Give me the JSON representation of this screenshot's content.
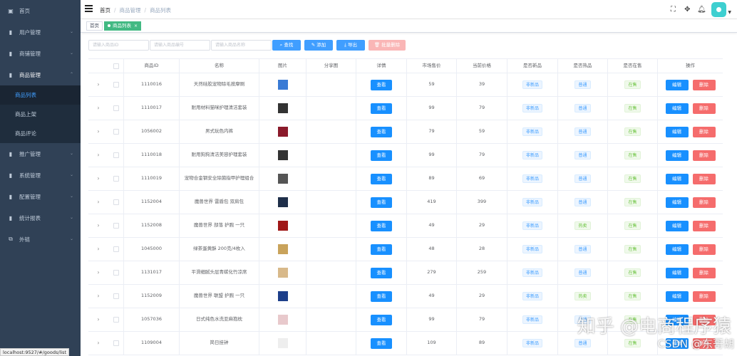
{
  "sidebar": {
    "items": [
      {
        "label": "首页",
        "icon": "dashboard-icon",
        "chevron": false
      },
      {
        "label": "用户管理",
        "icon": "bar-chart-icon",
        "chevron": true
      },
      {
        "label": "商铺管理",
        "icon": "bar-chart-icon",
        "chevron": true
      },
      {
        "label": "商品管理",
        "icon": "bar-chart-icon",
        "chevron": true,
        "open": true
      },
      {
        "label": "推广管理",
        "icon": "bar-chart-icon",
        "chevron": true
      },
      {
        "label": "系统管理",
        "icon": "bar-chart-icon",
        "chevron": true
      },
      {
        "label": "配置管理",
        "icon": "bar-chart-icon",
        "chevron": true
      },
      {
        "label": "统计报表",
        "icon": "bar-chart-icon",
        "chevron": true
      },
      {
        "label": "外链",
        "icon": "external-link-icon",
        "chevron": true
      }
    ],
    "sub_items": [
      "商品列表",
      "商品上架",
      "商品评论"
    ],
    "status_url": "localhost:9527/#/goods/list"
  },
  "navbar": {
    "breadcrumb": [
      "首页",
      "商品管理",
      "商品列表"
    ]
  },
  "tags": {
    "home": "首页",
    "active": "商品列表",
    "close": "×"
  },
  "filters": {
    "id_placeholder": "请输入商品ID",
    "code_placeholder": "请输入商品编号",
    "name_placeholder": "请输入商品名称",
    "search_label": "查找",
    "add_label": "添加",
    "export_label": "导出",
    "batch_delete_label": "批量删除"
  },
  "table": {
    "headers": [
      "商品ID",
      "名称",
      "图片",
      "分享图",
      "详情",
      "市场售价",
      "当前价格",
      "是否新品",
      "是否热品",
      "是否在售",
      "操作"
    ],
    "view_label": "查看",
    "edit_label": "编辑",
    "delete_label": "删除",
    "rows": [
      {
        "id": "1110016",
        "name": "天然硅胶宠物除毛按摩刷",
        "market": "59",
        "price": "39",
        "is_new": "非新品",
        "is_hot": "普通",
        "on_sale": "在售",
        "thumb_color": "#3a7bd5"
      },
      {
        "id": "1110017",
        "name": "耐用材料猫咪护理清洁套装",
        "market": "99",
        "price": "79",
        "is_new": "非新品",
        "is_hot": "普通",
        "on_sale": "在售",
        "thumb_color": "#333333"
      },
      {
        "id": "1056002",
        "name": "男式玩色内裤",
        "market": "79",
        "price": "59",
        "is_new": "非新品",
        "is_hot": "普通",
        "on_sale": "在售",
        "thumb_color": "#8b1a2b"
      },
      {
        "id": "1110018",
        "name": "耐用狗狗清洁美容护理套装",
        "market": "99",
        "price": "79",
        "is_new": "非新品",
        "is_hot": "普通",
        "on_sale": "在售",
        "thumb_color": "#333333"
      },
      {
        "id": "1110019",
        "name": "宠物合金钢安全除菌指甲护理组合",
        "market": "89",
        "price": "69",
        "is_new": "非新品",
        "is_hot": "普通",
        "on_sale": "在售",
        "thumb_color": "#555555"
      },
      {
        "id": "1152004",
        "name": "魔兽世界 雷盾包 双肩包",
        "market": "419",
        "price": "399",
        "is_new": "非新品",
        "is_hot": "普通",
        "on_sale": "在售",
        "thumb_color": "#1f2f4a"
      },
      {
        "id": "1152008",
        "name": "魔兽世界 部落 护腕 一只",
        "market": "49",
        "price": "29",
        "is_new": "非新品",
        "is_hot": "热卖",
        "on_sale": "在售",
        "thumb_color": "#a01818"
      },
      {
        "id": "1045000",
        "name": "绿茶蛋黄酥 200克/4枚入",
        "market": "48",
        "price": "28",
        "is_new": "非新品",
        "is_hot": "普通",
        "on_sale": "在售",
        "thumb_color": "#c9a35b"
      },
      {
        "id": "1131017",
        "name": "平滑细腻头层青碳化竹凉席",
        "market": "279",
        "price": "259",
        "is_new": "非新品",
        "is_hot": "普通",
        "on_sale": "在售",
        "thumb_color": "#d8b98a"
      },
      {
        "id": "1152009",
        "name": "魔兽世界 联盟 护腕 一只",
        "market": "49",
        "price": "29",
        "is_new": "非新品",
        "is_hot": "热卖",
        "on_sale": "在售",
        "thumb_color": "#1d3f8a"
      },
      {
        "id": "1057036",
        "name": "日式纯色水洗亚麻抱枕",
        "market": "99",
        "price": "79",
        "is_new": "非新品",
        "is_hot": "普通",
        "on_sale": "在售",
        "thumb_color": "#e8c9cc"
      },
      {
        "id": "1109004",
        "name": "简日挂钟",
        "market": "109",
        "price": "89",
        "is_new": "非新品",
        "is_hot": "普通",
        "on_sale": "在售",
        "thumb_color": "#eeeeee"
      }
    ]
  },
  "watermark": {
    "line1": "知乎 @电商程序猿",
    "line2": "CSDN @东哥胡"
  }
}
